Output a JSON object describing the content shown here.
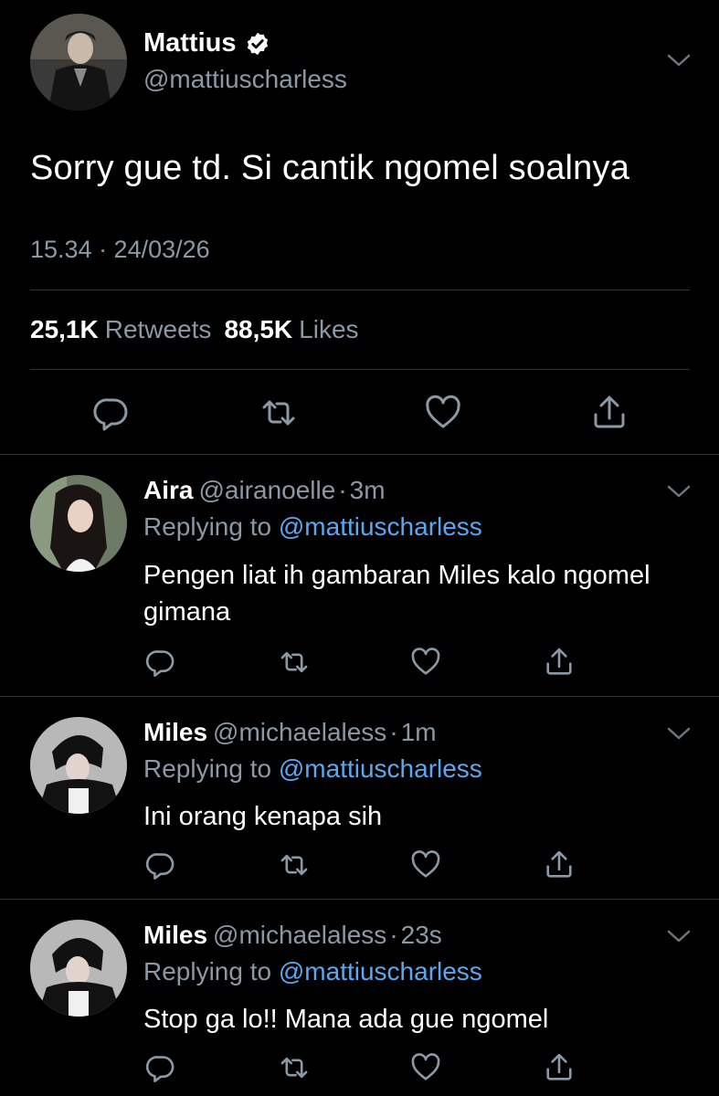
{
  "main_tweet": {
    "author_name": "Mattius",
    "author_handle": "@mattiuscharless",
    "text": "Sorry gue td. Si cantik ngomel soalnya",
    "timestamp": "15.34 · 24/03/26",
    "retweets_count": "25,1K",
    "retweets_label": "Retweets",
    "likes_count": "88,5K",
    "likes_label": "Likes",
    "icons": [
      "reply-icon",
      "retweet-icon",
      "like-icon",
      "share-icon"
    ]
  },
  "replies": [
    {
      "name": "Aira",
      "handle": "@airanoelle",
      "dot": "·",
      "time": "3m",
      "replying_prefix": "Replying to",
      "replying_to": "@mattiuscharless",
      "text": "Pengen liat ih gambaran Miles kalo ngomel gimana"
    },
    {
      "name": "Miles",
      "handle": "@michaelaless",
      "dot": "·",
      "time": "1m",
      "replying_prefix": "Replying to",
      "replying_to": "@mattiuscharless",
      "text": "Ini orang kenapa sih"
    },
    {
      "name": "Miles",
      "handle": "@michaelaless",
      "dot": "·",
      "time": "23s",
      "replying_prefix": "Replying to",
      "replying_to": "@mattiuscharless",
      "text": "Stop ga lo!! Mana ada gue ngomel"
    }
  ],
  "colors": {
    "background": "#000000",
    "text": "#ffffff",
    "secondary": "#8b98a5",
    "mention": "#5aa8f2",
    "divider": "#2f3336"
  }
}
